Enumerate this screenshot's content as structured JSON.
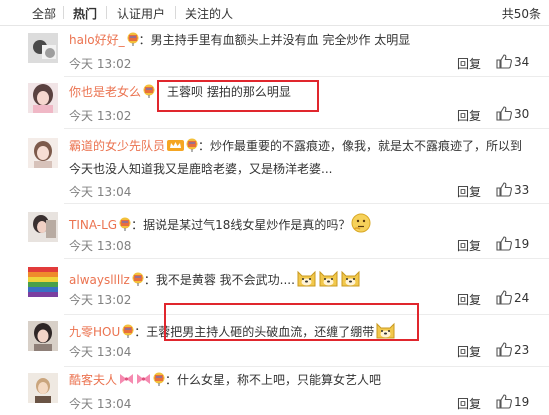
{
  "tabs": {
    "all": "全部",
    "hot": "热门",
    "verified": "认证用户",
    "following": "关注的人"
  },
  "total": "共50条",
  "colors": {
    "username": "#eb7350",
    "highlight_box": "#e0262d",
    "time": "#808080"
  },
  "comments": [
    {
      "user": "halo好好_",
      "sep": "：",
      "text": "男主持手里有血额头上并没有血   完全炒作  太明显",
      "time": "今天 13:02",
      "reply": "回复",
      "likes": "34"
    },
    {
      "user": "你也是老女么",
      "sep": "：",
      "text": "王蓉呗 摆拍的那么明显",
      "time": "今天 13:02",
      "reply": "回复",
      "likes": "30"
    },
    {
      "user": "霸道的女少先队员",
      "sep": "：",
      "text": "炒作最重要的不露痕迹，像我，就是太不露痕迹了，所以到",
      "text2": "今天也没人知道我又是鹿晗老婆，又是杨洋老婆...",
      "time": "今天 13:04",
      "reply": "回复",
      "likes": "33"
    },
    {
      "user": "TINA-LG",
      "sep": "：",
      "text": "据说是某过气18线女星炒作是真的吗？",
      "time": "今天 13:08",
      "reply": "回复",
      "likes": "19"
    },
    {
      "user": "alwaysllllz",
      "sep": "：",
      "text": "我不是黄蓉 我不会武功....",
      "time": "今天 13:02",
      "reply": "回复",
      "likes": "24"
    },
    {
      "user": "九零HOU",
      "sep": "：",
      "text": "王蓉把男主持人砸的头破血流，还缠了绷带",
      "time": "今天 13:04",
      "reply": "回复",
      "likes": "23"
    },
    {
      "user": "酷客夫人",
      "sep": "：",
      "text": "什么女星，称不上吧，只能算女艺人吧",
      "time": "今天 13:04",
      "reply": "回复",
      "likes": "19"
    }
  ]
}
